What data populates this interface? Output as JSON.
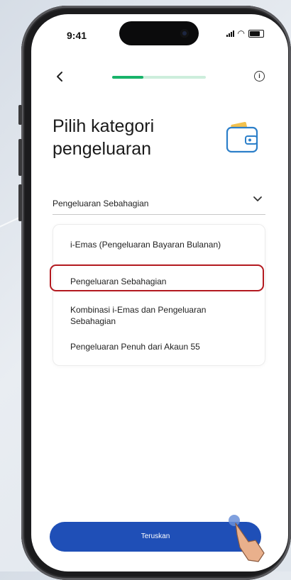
{
  "status_bar": {
    "time": "9:41"
  },
  "progress": {
    "fraction": 0.33
  },
  "header": {
    "title": "Pilih kategori pengeluaran"
  },
  "dropdown": {
    "selected": "Pengeluaran Sebahagian"
  },
  "options": [
    "i-Emas (Pengeluaran Bayaran Bulanan)",
    "Pengeluaran Sebahagian",
    "Kombinasi i-Emas dan Pengeluaran Sebahagian",
    "Pengeluaran Penuh dari Akaun 55"
  ],
  "highlight_color": "#b3191f",
  "accent_color": "#18b36a",
  "button": {
    "label": "Teruskan",
    "color": "#1f4fb7"
  },
  "icons": {
    "back": "chevron-left-icon",
    "info": "info-icon",
    "wallet": "wallet-icon",
    "dropdown": "chevron-down-icon"
  }
}
